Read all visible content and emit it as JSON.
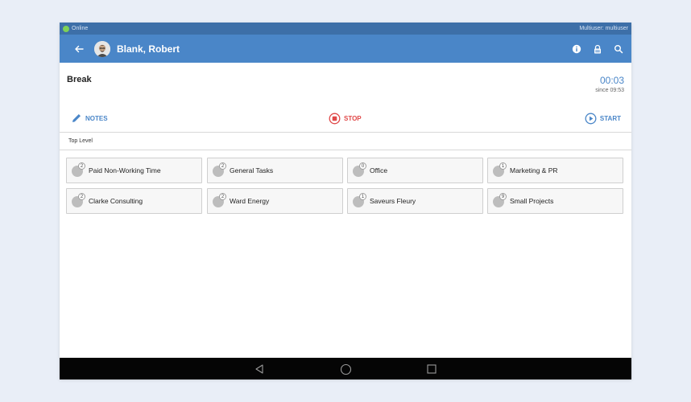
{
  "statusbar": {
    "connection": "Online",
    "user_label": "Multiuser: multiuser",
    "online_color": "#7ed157"
  },
  "header": {
    "user_name": "Blank, Robert",
    "icons": {
      "back": "arrow-left-icon",
      "info": "info-icon",
      "lock": "lock-icon",
      "search": "search-icon"
    },
    "color": "#4a86c8"
  },
  "current": {
    "title": "Break",
    "timer": "00:03",
    "since": "since 09:53"
  },
  "actions": {
    "notes": "NOTES",
    "stop": "STOP",
    "start": "START",
    "stop_color": "#e04848"
  },
  "breadcrumb": "Top Level",
  "tiles": [
    {
      "label": "Paid Non-Working Time",
      "count": "2"
    },
    {
      "label": "General Tasks",
      "count": "2"
    },
    {
      "label": "Office",
      "count": "0"
    },
    {
      "label": "Marketing & PR",
      "count": "1"
    },
    {
      "label": "Clarke Consulting",
      "count": "2"
    },
    {
      "label": "Ward Energy",
      "count": "2"
    },
    {
      "label": "Saveurs Fleury",
      "count": "1"
    },
    {
      "label": "Small Projects",
      "count": "9"
    }
  ],
  "navbar": {
    "back": "triangle-back-icon",
    "home": "circle-home-icon",
    "recents": "square-recents-icon"
  }
}
